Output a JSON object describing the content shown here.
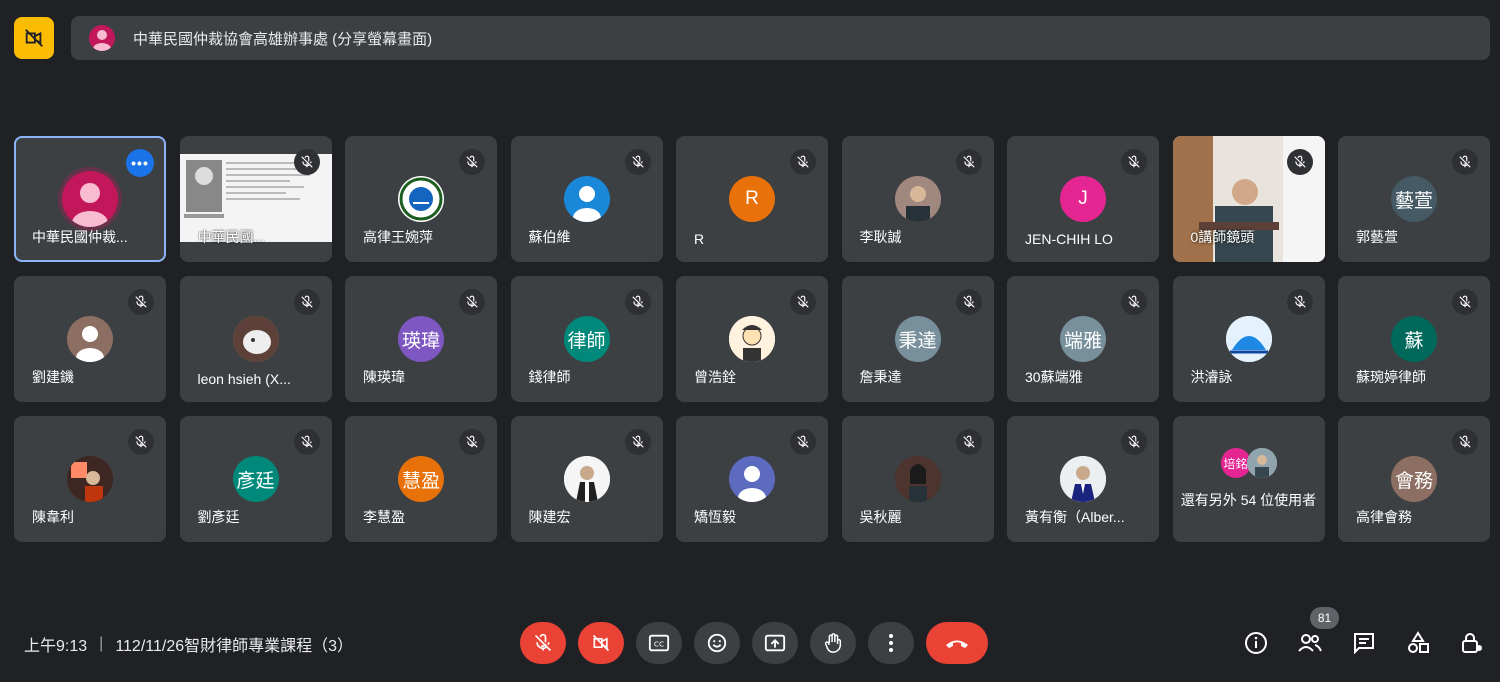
{
  "top_bar": {
    "title": "中華民國仲裁協會高雄辦事處 (分享螢幕畫面)"
  },
  "tiles": [
    {
      "name": "中華民國仲裁...",
      "type": "self"
    },
    {
      "name": "中華民國...",
      "type": "screen"
    },
    {
      "name": "高律王婉萍",
      "type": "logo"
    },
    {
      "name": "蘇伯維",
      "type": "person",
      "color": "#1a88d8"
    },
    {
      "name": "R",
      "type": "initial",
      "initial": "R",
      "color": "#e8710a"
    },
    {
      "name": "李耿誠",
      "type": "photo"
    },
    {
      "name": "JEN-CHIH LO",
      "type": "initial",
      "initial": "J",
      "color": "#e52592"
    },
    {
      "name": "0講師鏡頭",
      "type": "video"
    },
    {
      "name": "郭藝萱",
      "type": "initial",
      "initial": "藝萱",
      "color": "#455a64"
    },
    {
      "name": "劉建鐖",
      "type": "person",
      "color": "#8d6e63"
    },
    {
      "name": "leon hsieh (X...",
      "type": "photo"
    },
    {
      "name": "陳瑛瑋",
      "type": "initial",
      "initial": "瑛瑋",
      "color": "#7e57c2"
    },
    {
      "name": "錢律師",
      "type": "initial",
      "initial": "律師",
      "color": "#00897b"
    },
    {
      "name": "曾浩銓",
      "type": "photo"
    },
    {
      "name": "詹秉達",
      "type": "initial",
      "initial": "秉達",
      "color": "#78909c"
    },
    {
      "name": "30蘇端雅",
      "type": "initial",
      "initial": "端雅",
      "color": "#78909c"
    },
    {
      "name": "洪濬詠",
      "type": "photo"
    },
    {
      "name": "蘇琬婷律師",
      "type": "initial",
      "initial": "蘇",
      "color": "#00695c"
    },
    {
      "name": "陳韋利",
      "type": "photo"
    },
    {
      "name": "劉彥廷",
      "type": "initial",
      "initial": "彥廷",
      "color": "#00897b"
    },
    {
      "name": "李慧盈",
      "type": "initial",
      "initial": "慧盈",
      "color": "#e8710a"
    },
    {
      "name": "陳建宏",
      "type": "photo"
    },
    {
      "name": "矯恆毅",
      "type": "person",
      "color": "#5c6bc0"
    },
    {
      "name": "吳秋麗",
      "type": "photo"
    },
    {
      "name": "黃有衡（Alber...",
      "type": "photo"
    },
    {
      "name": "還有另外 54 位使用者",
      "type": "others",
      "initial": "培銘"
    },
    {
      "name": "高律會務",
      "type": "initial",
      "initial": "會務",
      "color": "#8d6e63"
    }
  ],
  "bottom": {
    "time": "上午9:13",
    "meeting": "112/11/26智財律師專業課程（3）",
    "participant_count": "81"
  },
  "colors": {
    "accent": "#8ab4f8",
    "danger": "#ea4335",
    "badge": "#fbbc04"
  }
}
